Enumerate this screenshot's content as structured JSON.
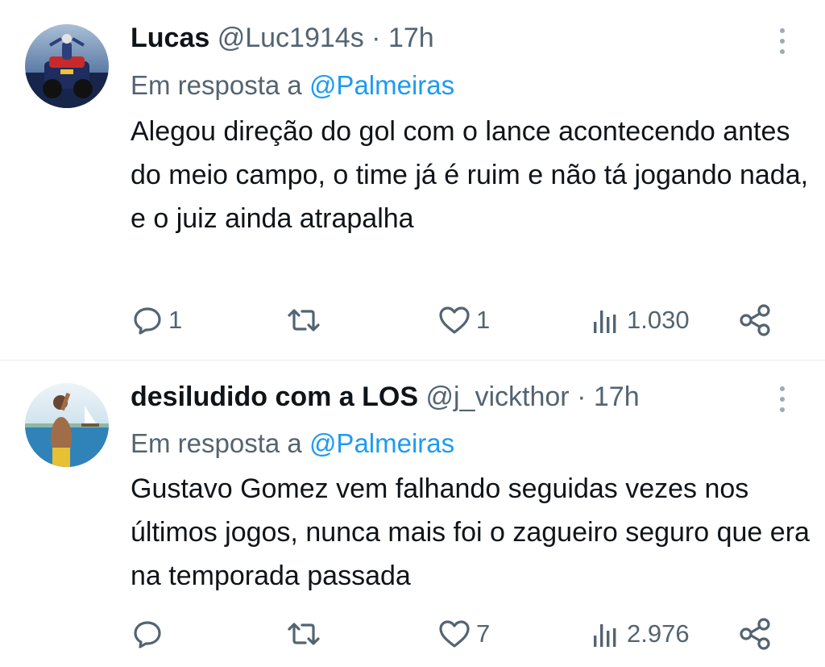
{
  "tweets": [
    {
      "display_name": "Lucas",
      "handle": "@Luc1914s",
      "separator": "·",
      "time": "17h",
      "reply_prefix": "Em resposta a",
      "reply_to": "@Palmeiras",
      "text": "Alegou direção do gol com o lance acontecendo antes do meio campo, o time já é ruim e não tá jogando nada, e o juiz ainda atrapalha",
      "replies": "1",
      "retweets": "",
      "likes": "1",
      "views": "1.030"
    },
    {
      "display_name": "desiludido com a LOS",
      "handle": "@j_vickthor",
      "separator": "·",
      "time": "17h",
      "reply_prefix": "Em resposta a",
      "reply_to": "@Palmeiras",
      "text": "Gustavo Gomez vem falhando seguidas vezes nos últimos jogos, nunca mais foi o zagueiro seguro que era na temporada passada",
      "replies": "",
      "retweets": "",
      "likes": "7",
      "views": "2.976"
    }
  ],
  "icons": {
    "reply": "speech-bubble-icon",
    "retweet": "retweet-arrows-icon",
    "like": "heart-icon",
    "views": "bar-chart-icon",
    "share": "share-nodes-icon",
    "more": "vertical-dots-icon"
  },
  "colors": {
    "text": "#0f1419",
    "secondary": "#536471",
    "link": "#1d9bf0",
    "divider": "#e6ecf0"
  }
}
